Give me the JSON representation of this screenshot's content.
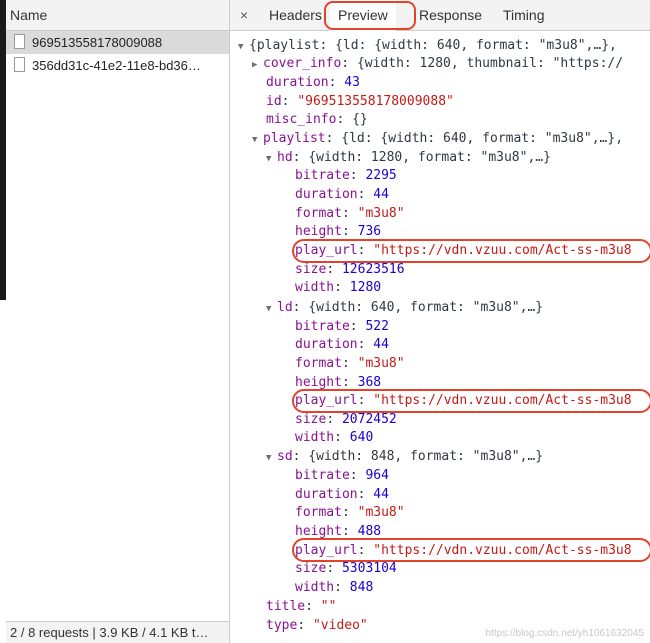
{
  "left_panel": {
    "column_header": "Name",
    "requests": [
      {
        "name": "969513558178009088",
        "selected": true
      },
      {
        "name": "356dd31c-41e2-11e8-bd36…",
        "selected": false
      }
    ],
    "status": "2 / 8 requests | 3.9 KB / 4.1 KB t…"
  },
  "tabs": {
    "close": "×",
    "items": [
      "Headers",
      "Preview",
      "Response",
      "Timing"
    ],
    "active": "Preview"
  },
  "preview": {
    "root_summary": "{playlist: {ld: {width: 640, format: \"m3u8\",…},",
    "cover_info_key": "cover_info",
    "cover_info_summary": "{width: 1280, thumbnail: \"https://",
    "duration_key": "duration",
    "duration_val": "43",
    "id_key": "id",
    "id_val": "\"969513558178009088\"",
    "misc_key": "misc_info",
    "misc_val": "{}",
    "playlist_key": "playlist",
    "playlist_summary": "{ld: {width: 640, format: \"m3u8\",…},",
    "hd": {
      "key": "hd",
      "summary": "{width: 1280, format: \"m3u8\",…}",
      "bitrate": "2295",
      "duration": "44",
      "format": "\"m3u8\"",
      "height": "736",
      "play_url": "\"https://vdn.vzuu.com/Act-ss-m3u8",
      "size": "12623516",
      "width": "1280"
    },
    "ld": {
      "key": "ld",
      "summary": "{width: 640, format: \"m3u8\",…}",
      "bitrate": "522",
      "duration": "44",
      "format": "\"m3u8\"",
      "height": "368",
      "play_url": "\"https://vdn.vzuu.com/Act-ss-m3u8",
      "size": "2072452",
      "width": "640"
    },
    "sd": {
      "key": "sd",
      "summary": "{width: 848, format: \"m3u8\",…}",
      "bitrate": "964",
      "duration": "44",
      "format": "\"m3u8\"",
      "height": "488",
      "play_url": "\"https://vdn.vzuu.com/Act-ss-m3u8",
      "size": "5303104",
      "width": "848"
    },
    "title_key": "title",
    "title_val": "\"\"",
    "type_key": "type",
    "type_val": "\"video\"",
    "labels": {
      "bitrate": "bitrate",
      "duration": "duration",
      "format": "format",
      "height": "height",
      "play_url": "play_url",
      "size": "size",
      "width": "width"
    }
  },
  "watermark": "https://blog.csdn.net/yh1061632045",
  "colors": {
    "key": "#881391",
    "string": "#c41a16",
    "number": "#1c00cf",
    "highlight": "#e0442a"
  }
}
